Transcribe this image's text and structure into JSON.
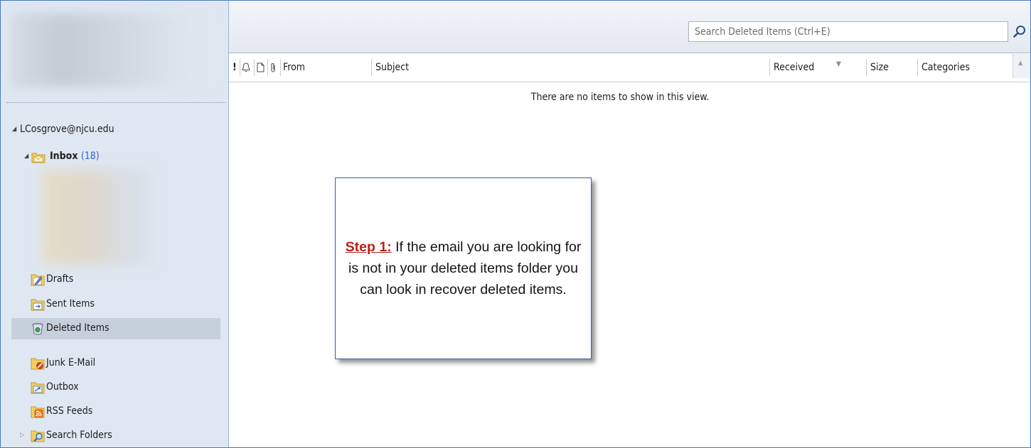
{
  "nav": {
    "account": "LCosgrove@njcu.edu",
    "inbox_label": "Inbox",
    "inbox_count": "(18)",
    "folders": [
      {
        "label": "Drafts",
        "icon": "drafts-icon"
      },
      {
        "label": "Sent Items",
        "icon": "sent-items-icon"
      },
      {
        "label": "Deleted Items",
        "icon": "deleted-items-icon",
        "selected": true
      },
      {
        "label": "Junk E-Mail",
        "icon": "junk-email-icon"
      },
      {
        "label": "Outbox",
        "icon": "outbox-icon"
      },
      {
        "label": "RSS Feeds",
        "icon": "rss-feeds-icon"
      },
      {
        "label": "Search Folders",
        "icon": "search-folders-icon"
      }
    ]
  },
  "search": {
    "placeholder": "Search Deleted Items (Ctrl+E)"
  },
  "columns": {
    "importance": "!",
    "from": "From",
    "subject": "Subject",
    "received": "Received",
    "size": "Size",
    "categories": "Categories"
  },
  "message_list": {
    "empty_text": "There are no items to show in this view."
  },
  "callout": {
    "step": "Step 1:",
    "text": " If the email you are looking for is not in your deleted items folder you can look in recover deleted items."
  },
  "colors": {
    "accent_blue": "#4a78c2",
    "nav_background": "#dfe7f2",
    "selected_item": "#c6cfdc",
    "step_red": "#b8211b"
  }
}
